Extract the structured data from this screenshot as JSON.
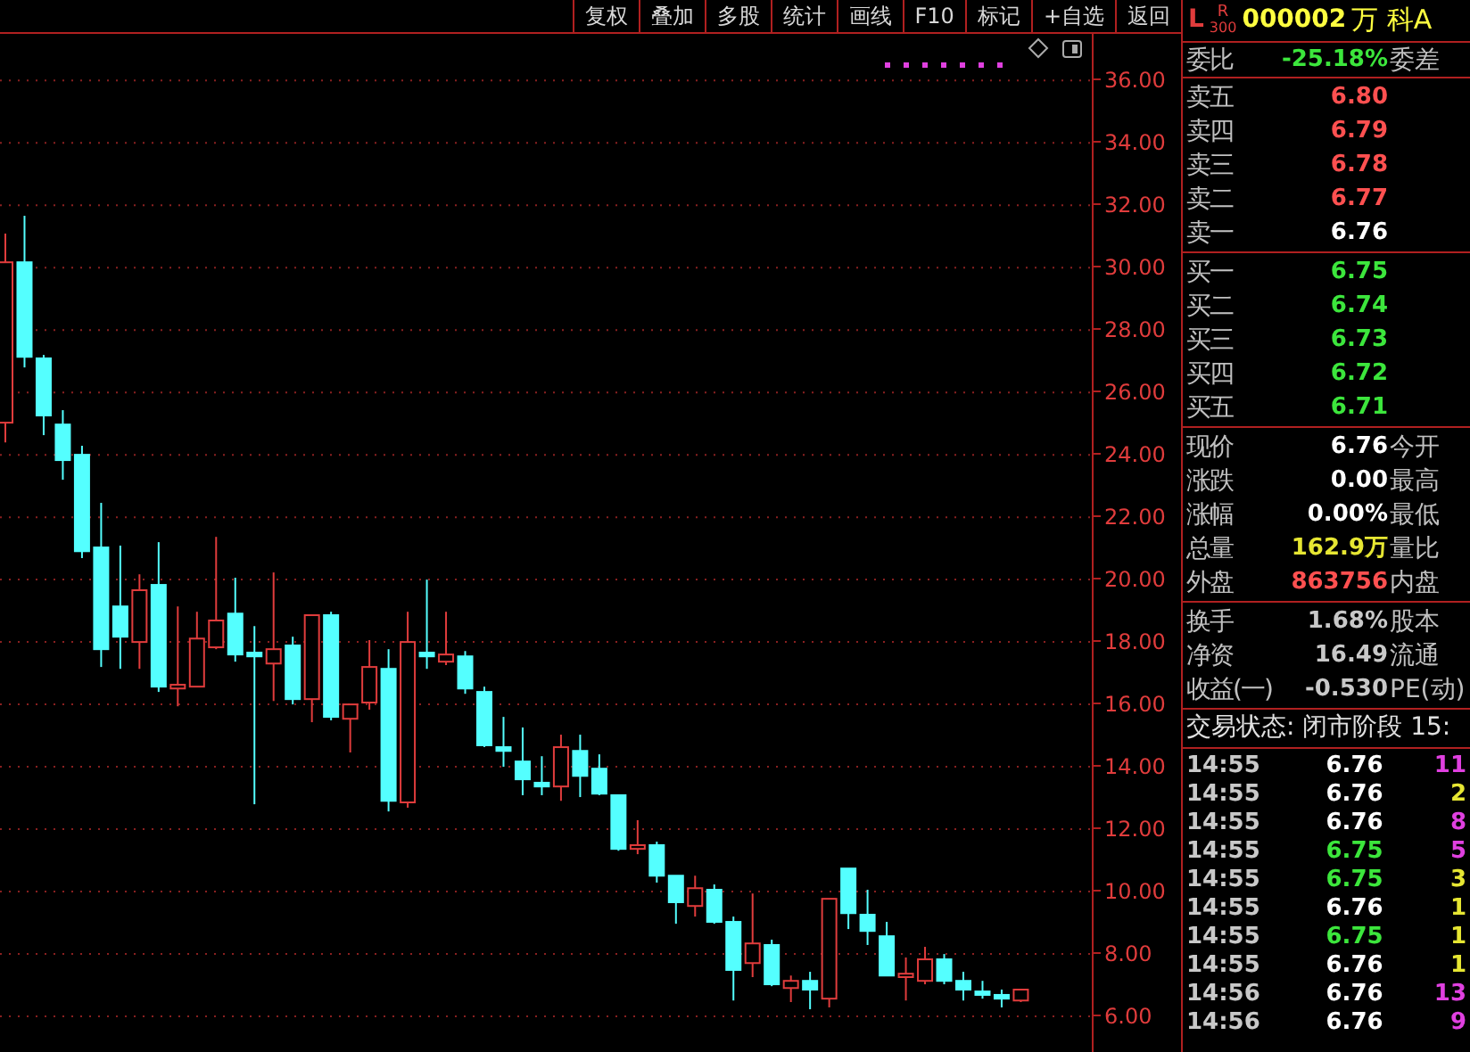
{
  "toolbar": [
    "复权",
    "叠加",
    "多股",
    "统计",
    "画线",
    "F10",
    "标记",
    "+自选",
    "返回"
  ],
  "chart": {
    "chart_data": {
      "type": "candlestick",
      "grid": true,
      "ylim": [
        4.86,
        37.49
      ],
      "yticks": [
        {
          "value": 36,
          "label": "36.00"
        },
        {
          "value": 34,
          "label": "34.00"
        },
        {
          "value": 32,
          "label": "32.00"
        },
        {
          "value": 30,
          "label": "30.00"
        },
        {
          "value": 28,
          "label": "28.00"
        },
        {
          "value": 26,
          "label": "26.00"
        },
        {
          "value": 24,
          "label": "24.00"
        },
        {
          "value": 22,
          "label": "22.00"
        },
        {
          "value": 20,
          "label": "20.00"
        },
        {
          "value": 18,
          "label": "18.00"
        },
        {
          "value": 16,
          "label": "16.00"
        },
        {
          "value": 14,
          "label": "14.00"
        },
        {
          "value": 12,
          "label": "12.00"
        },
        {
          "value": 10,
          "label": "10.00"
        },
        {
          "value": 8,
          "label": "8.00"
        },
        {
          "value": 6,
          "label": "6.00"
        }
      ],
      "ohlc": [
        [
          25.03,
          31.09,
          24.4,
          30.17
        ],
        [
          30.17,
          31.66,
          26.8,
          27.14
        ],
        [
          27.09,
          27.2,
          24.63,
          25.26
        ],
        [
          24.97,
          25.43,
          23.2,
          23.83
        ],
        [
          24.0,
          24.29,
          20.69,
          20.91
        ],
        [
          21.03,
          22.46,
          17.2,
          17.77
        ],
        [
          19.14,
          21.09,
          17.14,
          18.17
        ],
        [
          18.0,
          20.17,
          17.14,
          19.66
        ],
        [
          19.83,
          21.2,
          16.4,
          16.57
        ],
        [
          16.51,
          19.14,
          15.94,
          16.63
        ],
        [
          16.57,
          18.97,
          16.57,
          18.11
        ],
        [
          17.83,
          21.37,
          17.77,
          18.69
        ],
        [
          18.91,
          20.06,
          17.37,
          17.6
        ],
        [
          17.66,
          18.51,
          12.8,
          17.54
        ],
        [
          17.31,
          20.23,
          16.11,
          17.77
        ],
        [
          17.89,
          18.17,
          16.0,
          16.17
        ],
        [
          16.17,
          18.86,
          15.43,
          18.86
        ],
        [
          18.86,
          18.97,
          15.49,
          15.6
        ],
        [
          15.54,
          16.0,
          14.46,
          16.0
        ],
        [
          16.06,
          18.06,
          15.83,
          17.2
        ],
        [
          17.14,
          17.77,
          12.57,
          12.91
        ],
        [
          12.86,
          18.97,
          12.69,
          18.0
        ],
        [
          17.66,
          20.0,
          17.14,
          17.54
        ],
        [
          17.37,
          18.97,
          17.26,
          17.6
        ],
        [
          17.54,
          17.71,
          16.34,
          16.51
        ],
        [
          16.4,
          16.57,
          14.63,
          14.69
        ],
        [
          14.63,
          15.6,
          14.0,
          14.51
        ],
        [
          14.17,
          15.26,
          13.09,
          13.6
        ],
        [
          13.49,
          14.34,
          13.09,
          13.37
        ],
        [
          13.37,
          15.03,
          12.91,
          14.63
        ],
        [
          14.51,
          15.03,
          13.03,
          13.71
        ],
        [
          13.94,
          14.4,
          13.09,
          13.14
        ],
        [
          13.09,
          13.09,
          11.31,
          11.37
        ],
        [
          11.37,
          12.29,
          11.2,
          11.49
        ],
        [
          11.49,
          11.6,
          10.29,
          10.51
        ],
        [
          10.51,
          10.51,
          8.97,
          9.66
        ],
        [
          9.54,
          10.51,
          9.2,
          10.11
        ],
        [
          10.06,
          10.23,
          8.97,
          9.03
        ],
        [
          9.03,
          9.2,
          6.51,
          7.49
        ],
        [
          7.71,
          9.94,
          7.26,
          8.34
        ],
        [
          8.29,
          8.46,
          6.97,
          7.03
        ],
        [
          6.91,
          7.31,
          6.46,
          7.14
        ],
        [
          7.14,
          7.43,
          6.23,
          6.86
        ],
        [
          6.57,
          9.77,
          6.29,
          9.77
        ],
        [
          10.74,
          10.74,
          8.8,
          9.31
        ],
        [
          9.26,
          10.06,
          8.29,
          8.74
        ],
        [
          8.57,
          9.03,
          7.31,
          7.31
        ],
        [
          7.26,
          7.89,
          6.51,
          7.37
        ],
        [
          7.14,
          8.23,
          7.03,
          7.83
        ],
        [
          7.83,
          8.0,
          7.03,
          7.14
        ],
        [
          7.14,
          7.43,
          6.51,
          6.86
        ],
        [
          6.8,
          7.14,
          6.57,
          6.69
        ],
        [
          6.69,
          6.86,
          6.29,
          6.57
        ],
        [
          6.51,
          6.86,
          6.46,
          6.86
        ]
      ]
    }
  },
  "header": {
    "market": "L",
    "index_mark": "R",
    "index_sub": "300",
    "code": "000002",
    "name": "万 科A"
  },
  "order_ratio": {
    "label": "委比",
    "value": "-25.18%",
    "color": "#3ce63c",
    "label2": "委差"
  },
  "asks": [
    {
      "label": "卖五",
      "price": "6.80",
      "color": "#ff5050"
    },
    {
      "label": "卖四",
      "price": "6.79",
      "color": "#ff5050"
    },
    {
      "label": "卖三",
      "price": "6.78",
      "color": "#ff5050"
    },
    {
      "label": "卖二",
      "price": "6.77",
      "color": "#ff5050"
    },
    {
      "label": "卖一",
      "price": "6.76",
      "color": "#ffffff"
    }
  ],
  "bids": [
    {
      "label": "买一",
      "price": "6.75",
      "color": "#3ce63c"
    },
    {
      "label": "买二",
      "price": "6.74",
      "color": "#3ce63c"
    },
    {
      "label": "买三",
      "price": "6.73",
      "color": "#3ce63c"
    },
    {
      "label": "买四",
      "price": "6.72",
      "color": "#3ce63c"
    },
    {
      "label": "买五",
      "price": "6.71",
      "color": "#3ce63c"
    }
  ],
  "quote": [
    {
      "label": "现价",
      "value": "6.76",
      "color": "#ffffff",
      "label2": "今开"
    },
    {
      "label": "涨跌",
      "value": "0.00",
      "color": "#ffffff",
      "label2": "最高"
    },
    {
      "label": "涨幅",
      "value": "0.00%",
      "color": "#ffffff",
      "label2": "最低"
    },
    {
      "label": "总量",
      "value": "162.9万",
      "color": "#e6e632",
      "label2": "量比"
    },
    {
      "label": "外盘",
      "value": "863756",
      "color": "#ff5050",
      "label2": "内盘"
    }
  ],
  "fundamentals": [
    {
      "label": "换手",
      "value": "1.68%",
      "label2": "股本"
    },
    {
      "label": "净资",
      "value": "16.49",
      "label2": "流通"
    },
    {
      "label": "收益(一)",
      "value": "-0.530",
      "label2": "PE(动)"
    }
  ],
  "status": "交易状态: 闭市阶段 15:",
  "trades": [
    {
      "time": "14:55",
      "price": {
        "text": "6.76",
        "color": "#ffffff"
      },
      "volume": {
        "text": "11",
        "color": "#e040e0"
      }
    },
    {
      "time": "14:55",
      "price": {
        "text": "6.76",
        "color": "#ffffff"
      },
      "volume": {
        "text": "2",
        "color": "#e6e632"
      }
    },
    {
      "time": "14:55",
      "price": {
        "text": "6.76",
        "color": "#ffffff"
      },
      "volume": {
        "text": "8",
        "color": "#e040e0"
      }
    },
    {
      "time": "14:55",
      "price": {
        "text": "6.75",
        "color": "#3ce63c"
      },
      "volume": {
        "text": "5",
        "color": "#e040e0"
      }
    },
    {
      "time": "14:55",
      "price": {
        "text": "6.75",
        "color": "#3ce63c"
      },
      "volume": {
        "text": "3",
        "color": "#e6e632"
      }
    },
    {
      "time": "14:55",
      "price": {
        "text": "6.76",
        "color": "#ffffff"
      },
      "volume": {
        "text": "1",
        "color": "#e6e632"
      }
    },
    {
      "time": "14:55",
      "price": {
        "text": "6.75",
        "color": "#3ce63c"
      },
      "volume": {
        "text": "1",
        "color": "#e6e632"
      }
    },
    {
      "time": "14:55",
      "price": {
        "text": "6.76",
        "color": "#ffffff"
      },
      "volume": {
        "text": "1",
        "color": "#e6e632"
      }
    },
    {
      "time": "14:56",
      "price": {
        "text": "6.76",
        "color": "#ffffff"
      },
      "volume": {
        "text": "13",
        "color": "#e040e0"
      }
    },
    {
      "time": "14:56",
      "price": {
        "text": "6.76",
        "color": "#ffffff"
      },
      "volume": {
        "text": "9",
        "color": "#e040e0"
      }
    }
  ]
}
